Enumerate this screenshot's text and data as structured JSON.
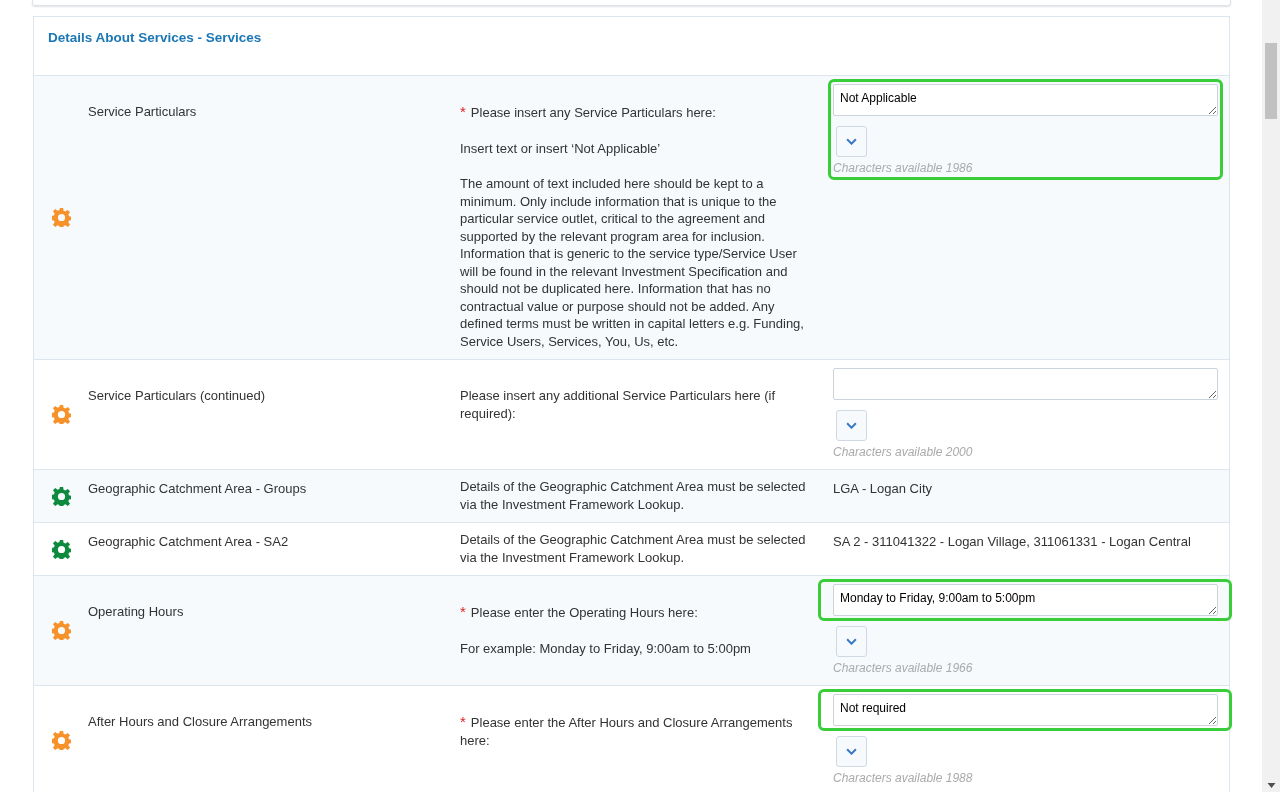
{
  "section": {
    "title": "Details About Services - Services"
  },
  "rows": [
    {
      "label": "Service Particulars",
      "color": "#f7922a",
      "description": {
        "marker": "*",
        "paragraphs": [
          "Please insert any Service Particulars here:",
          "Insert text or insert ‘Not Applicable’",
          "The amount of text included here should be kept to a minimum. Only include information that is unique to the particular service outlet, critical to the agreement and supported by the relevant program area for inclusion. Information that is generic to the service type/Service User will be found in the relevant Investment Specification and should not be duplicated here. Information that has no contractual value or purpose should not be added. Any defined terms must be written in capital letters e.g. Funding, Service Users, Services, You, Us, etc."
        ]
      },
      "value": {
        "kind": "textarea",
        "value": "Not Applicable",
        "chars": "Characters available 1986",
        "highlighted": true,
        "field_highlighted": false
      }
    },
    {
      "label": "Service Particulars (continued)",
      "color": "#f7922a",
      "description": {
        "paragraphs": [
          "Please insert any additional Service Particulars here (if required):"
        ]
      },
      "value": {
        "kind": "textarea",
        "chars": "Characters available 2000",
        "highlighted": false,
        "field_highlighted": false
      }
    },
    {
      "label": "Geographic Catchment Area - Groups",
      "color": "#0e8a3e",
      "description": {
        "paragraphs": [
          "Details of the Geographic Catchment Area must be selected via the Investment Framework Lookup."
        ]
      },
      "value": {
        "kind": "text",
        "value": "LGA - Logan City"
      }
    },
    {
      "label": "Geographic Catchment Area - SA2",
      "color": "#0e8a3e",
      "description": {
        "paragraphs": [
          "Details of the Geographic Catchment Area must be selected via the Investment Framework Lookup."
        ]
      },
      "value": {
        "kind": "text",
        "value": "SA 2 - 311041322 - Logan Village, 311061331 - Logan Central"
      }
    },
    {
      "label": "Operating Hours",
      "color": "#f7922a",
      "description": {
        "marker": "*",
        "paragraphs": [
          "Please enter the Operating Hours here:",
          "For example: Monday to Friday, 9:00am to 5:00pm"
        ]
      },
      "value": {
        "kind": "textarea",
        "value": "Monday to Friday, 9:00am to 5:00pm",
        "chars": "Characters available 1966",
        "highlighted": false,
        "field_highlighted": true
      }
    },
    {
      "label": "After Hours and Closure Arrangements",
      "color": "#f7922a",
      "description": {
        "marker": "*",
        "paragraphs": [
          "Please enter the After Hours and Closure Arrangements here:"
        ]
      },
      "value": {
        "kind": "textarea",
        "value": "Not required",
        "chars": "Characters available 1988",
        "highlighted": false,
        "field_highlighted": true
      }
    }
  ]
}
